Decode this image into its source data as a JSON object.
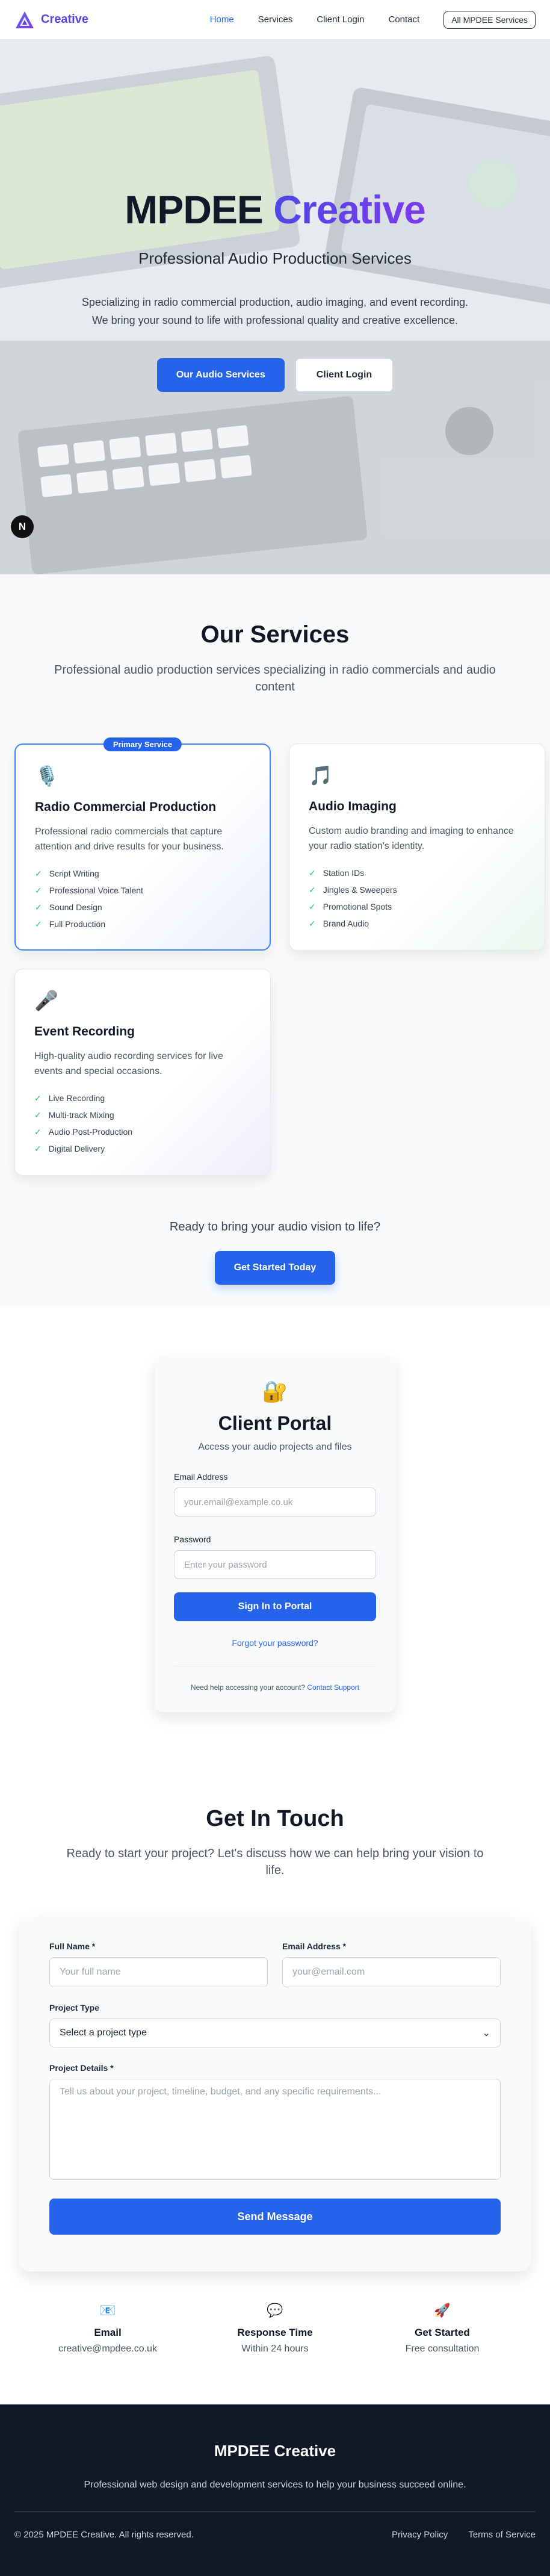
{
  "nav": {
    "brand": "Creative",
    "links": [
      "Home",
      "Services",
      "Client Login",
      "Contact"
    ],
    "all_button": "All MPDEE Services",
    "active_color": "#2563eb"
  },
  "hero": {
    "title_main": "MPDEE",
    "title_accent": "Creative",
    "subtitle": "Professional Audio Production Services",
    "description": "Specializing in radio commercial production, audio imaging, and event recording. We bring your sound to life with professional quality and creative excellence.",
    "primary_button": "Our Audio Services",
    "secondary_button": "Client Login",
    "badge_letter": "N"
  },
  "services": {
    "title": "Our Services",
    "subtitle": "Professional audio production services specializing in radio commercials and audio content",
    "cards": [
      {
        "badge": "Primary Service",
        "icon": "microphone-studio-icon",
        "glyph": "🎙️",
        "title": "Radio Commercial Production",
        "description": "Professional radio commercials that capture attention and drive results for your business.",
        "features": [
          "Script Writing",
          "Professional Voice Talent",
          "Sound Design",
          "Full Production"
        ]
      },
      {
        "badge": "",
        "icon": "music-note-icon",
        "glyph": "🎵",
        "title": "Audio Imaging",
        "description": "Custom audio branding and imaging to enhance your radio station's identity.",
        "features": [
          "Station IDs",
          "Jingles & Sweepers",
          "Promotional Spots",
          "Brand Audio"
        ]
      },
      {
        "badge": "",
        "icon": "microphone-icon",
        "glyph": "🎤",
        "title": "Event Recording",
        "description": "High-quality audio recording services for live events and special occasions.",
        "features": [
          "Live Recording",
          "Multi-track Mixing",
          "Audio Post-Production",
          "Digital Delivery"
        ]
      }
    ],
    "cta_text": "Ready to bring your audio vision to life?",
    "cta_button": "Get Started Today"
  },
  "portal": {
    "title": "Client Portal",
    "subtitle": "Access your audio projects and files",
    "email_label": "Email Address",
    "email_placeholder": "your.email@example.co.uk",
    "password_label": "Password",
    "password_placeholder": "Enter your password",
    "signin_button": "Sign In to Portal",
    "forgot": "Forgot your password?",
    "help_text": "Need help accessing your account?",
    "help_link": "Contact Support"
  },
  "contact": {
    "title": "Get In Touch",
    "subtitle": "Ready to start your project? Let's discuss how we can help bring your vision to life.",
    "full_name_label": "Full Name *",
    "full_name_placeholder": "Your full name",
    "email_label": "Email Address *",
    "email_placeholder": "your@email.com",
    "project_type_label": "Project Type",
    "project_type_value": "Select a project type",
    "details_label": "Project Details *",
    "details_placeholder": "Tell us about your project, timeline, budget, and any specific requirements...",
    "send_button": "Send Message",
    "info": [
      {
        "icon": "email-icon",
        "glyph": "📧",
        "title": "Email",
        "value": "creative@mpdee.co.uk"
      },
      {
        "icon": "chat-bubble-icon",
        "glyph": "💬",
        "title": "Response Time",
        "value": "Within 24 hours"
      },
      {
        "icon": "rocket-icon",
        "glyph": "🚀",
        "title": "Get Started",
        "value": "Free consultation"
      }
    ]
  },
  "footer": {
    "title": "MPDEE Creative",
    "description": "Professional web design and development services to help your business succeed online.",
    "copyright": "© 2025 MPDEE Creative. All rights reserved.",
    "links": [
      "Privacy Policy",
      "Terms of Service"
    ]
  }
}
